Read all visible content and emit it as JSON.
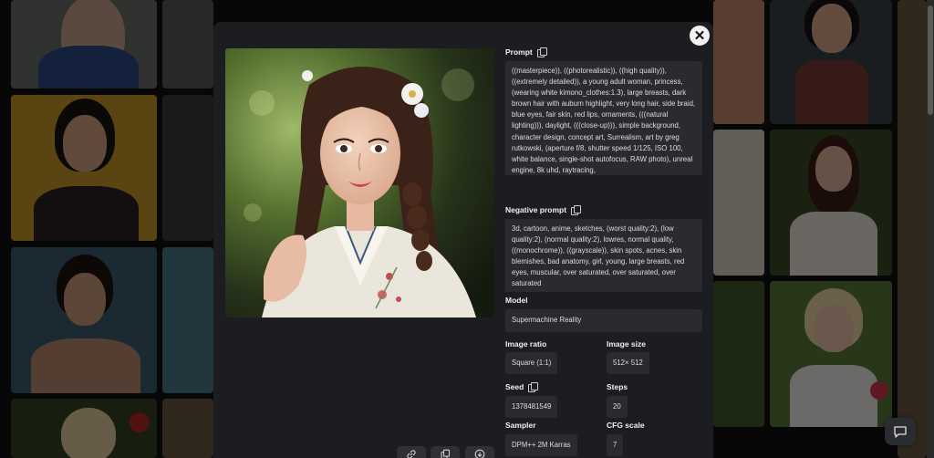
{
  "modal": {
    "close_glyph": "✕",
    "prompt_label": "Prompt",
    "prompt_text": "((masterpiece)), ((photorealistic)), ((high quality)), ((extremely detailed)), a young adult woman, princess, (wearing white kimono_clothes:1.3), large breasts, dark brown hair with auburn highlight, very long hair, side braid, blue eyes, fair skin, red lips, ornaments, (((natural lighting))), daylight, (((close-up))), simple background, character design, concept art, Surrealism, art by greg rutkowski, (aperture f/8, shutter speed 1/125, ISO 100, white balance, single-shot autofocus, RAW photo), unreal engine, 8k uhd, raytracing,",
    "negative_label": "Negative prompt",
    "negative_text": "3d, cartoon, anime, sketches, (worst quality:2), (low quality:2), (normal quality:2), lowres, normal quality, ((monochrome)), ((grayscale)), skin spots, acnes, skin blemishes, bad anatomy, girl, young, large breasts, red eyes, muscular, over saturated, over saturated, over saturated",
    "model_label": "Model",
    "model_value": "Supermachine Reality",
    "ratio_label": "Image ratio",
    "ratio_value": "Square (1:1)",
    "size_label": "Image size",
    "size_value": "512× 512",
    "seed_label": "Seed",
    "seed_value": "1378481549",
    "steps_label": "Steps",
    "steps_value": "20",
    "sampler_label": "Sampler",
    "sampler_value": "DPM++ 2M Karras",
    "cfg_label": "CFG scale",
    "cfg_value": "7"
  },
  "bottom_actions": [
    "link-icon",
    "copy-icon",
    "download-icon"
  ],
  "colors": {
    "modal_bg": "#1c1d20",
    "field_bg": "#2a2b2f",
    "page_bg": "#101010"
  }
}
